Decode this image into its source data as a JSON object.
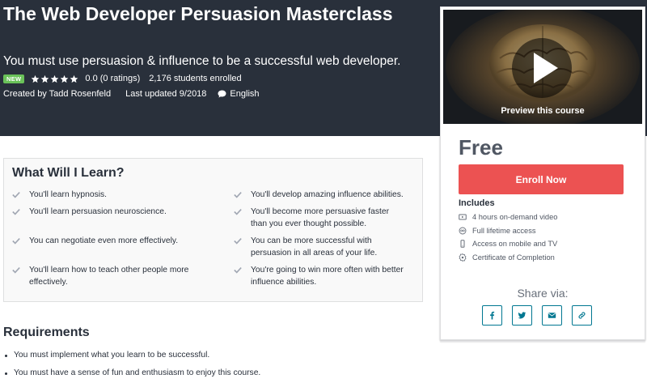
{
  "course": {
    "title": "The Web Developer Persuasion Masterclass",
    "subtitle": "You must use persuasion & influence to be a successful web developer.",
    "badge": "NEW",
    "rating_value": 0.0,
    "rating_text": "0.0 (0 ratings)",
    "enrolled_text": "2,176 students enrolled",
    "created_by": "Created by Tadd Rosenfeld",
    "last_updated": "Last updated 9/2018",
    "language": "English"
  },
  "sidebar": {
    "preview_label": "Preview this course",
    "price": "Free",
    "enroll_label": "Enroll Now",
    "includes_title": "Includes",
    "includes": [
      {
        "icon": "video-icon",
        "text": "4 hours on-demand video"
      },
      {
        "icon": "infinity-icon",
        "text": "Full lifetime access"
      },
      {
        "icon": "mobile-icon",
        "text": "Access on mobile and TV"
      },
      {
        "icon": "certificate-icon",
        "text": "Certificate of Completion"
      }
    ],
    "share_label": "Share via:",
    "share_icons": [
      "facebook-icon",
      "twitter-icon",
      "email-icon",
      "link-icon"
    ]
  },
  "learn": {
    "title": "What Will I Learn?",
    "items": [
      "You'll learn hypnosis.",
      "You'll develop amazing influence abilities.",
      "You'll learn persuasion neuroscience.",
      "You'll become more persuasive faster than you ever thought possible.",
      "You can negotiate even more effectively.",
      "You can be more successful with persuasion in all areas of your life.",
      "You'll learn how to teach other people more effectively.",
      "You're going to win more often with better influence abilities."
    ]
  },
  "requirements": {
    "title": "Requirements",
    "items": [
      "You must implement what you learn to be successful.",
      "You must have a sense of fun and enthusiasm to enjoy this course."
    ]
  },
  "colors": {
    "hero_bg": "#29303b",
    "enroll_button": "#ec5252",
    "new_badge": "#6ac259",
    "share_accent": "#007791"
  }
}
